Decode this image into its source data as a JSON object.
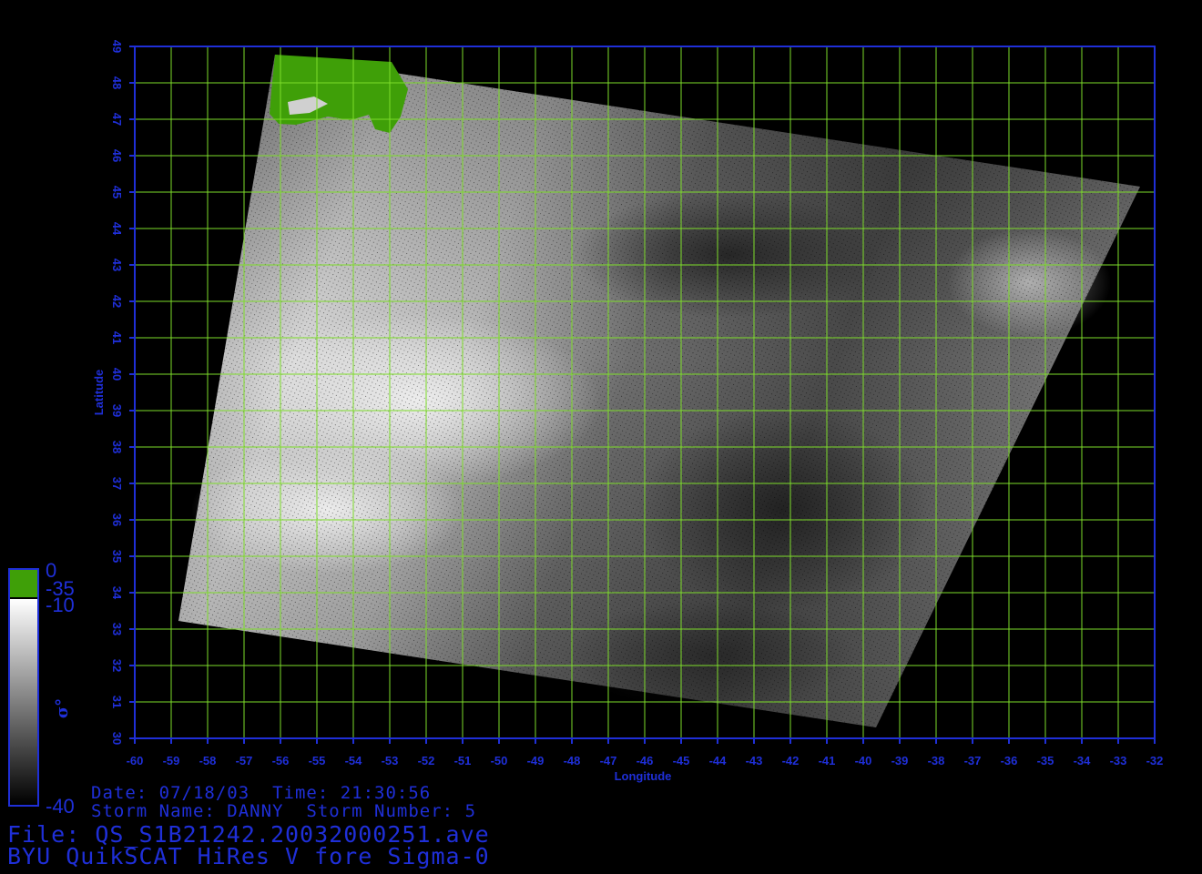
{
  "map": {
    "lon_range": [
      -60,
      -32
    ],
    "lat_range": [
      30,
      49
    ],
    "grid_step_deg": 1,
    "x_ticks": [
      "-60",
      "-59",
      "-58",
      "-57",
      "-56",
      "-55",
      "-54",
      "-53",
      "-52",
      "-51",
      "-50",
      "-49",
      "-48",
      "-47",
      "-46",
      "-45",
      "-44",
      "-43",
      "-42",
      "-41",
      "-40",
      "-39",
      "-38",
      "-37",
      "-36",
      "-35",
      "-34",
      "-33",
      "-32"
    ],
    "y_ticks": [
      "30",
      "31",
      "32",
      "33",
      "34",
      "35",
      "36",
      "37",
      "38",
      "39",
      "40",
      "41",
      "42",
      "43",
      "44",
      "45",
      "46",
      "47",
      "48",
      "49"
    ],
    "xlabel": "Longitude",
    "ylabel": "Latitude",
    "colors": {
      "axis": "#1f2fd8",
      "grid": "#7ddc2a",
      "land": "#3f9f08",
      "background": "#000000"
    },
    "colorbar": {
      "labels": [
        "0",
        "-35",
        "-10",
        "-40"
      ],
      "symbol": "σ°",
      "gradient": "black to white, green land mask band at top"
    },
    "image_description_only_for_rendering": "grayscale backscatter swath"
  },
  "info": {
    "date_label": "Date:",
    "date": "07/18/03",
    "time_label": "Time:",
    "time": "21:30:56",
    "storm_name_label": "Storm Name:",
    "storm_name": "DANNY",
    "storm_number_label": "Storm Number:",
    "storm_number": "5",
    "file_label": "File:",
    "file": "QS_S1B21242.20032000251.ave",
    "title": "BYU QuikSCAT HiRes V fore Sigma-0"
  }
}
